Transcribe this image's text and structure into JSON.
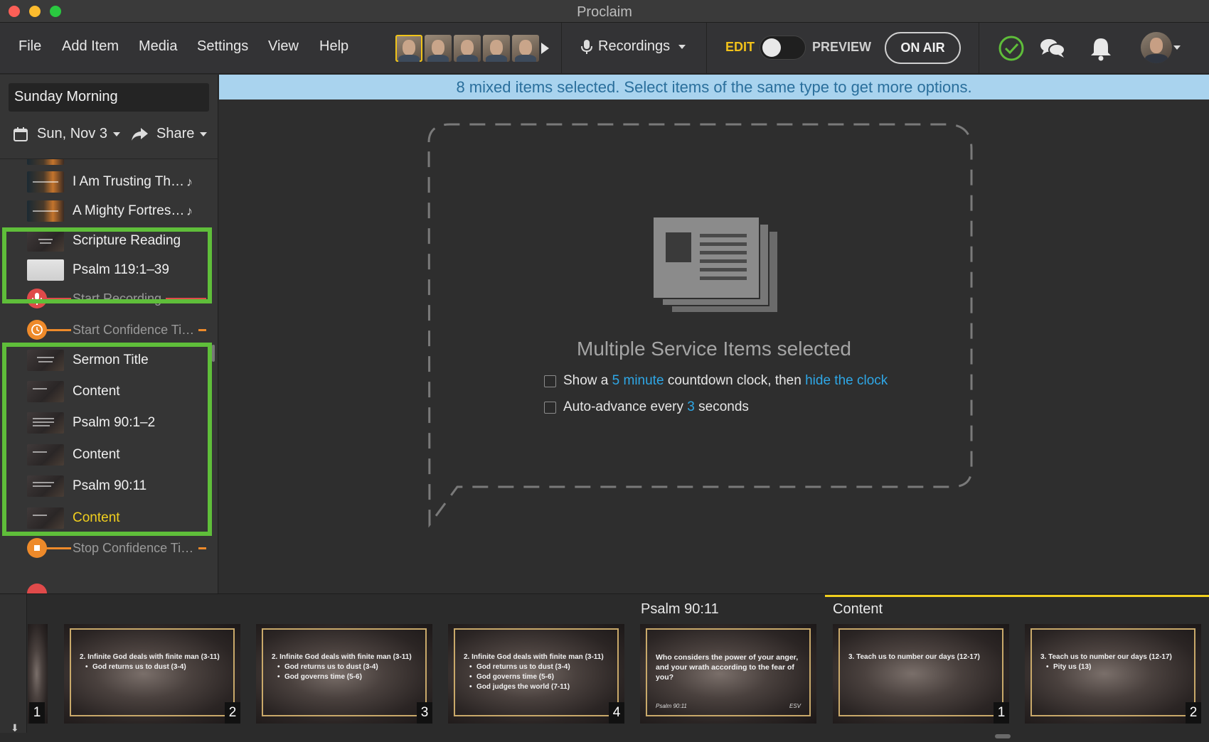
{
  "window": {
    "title": "Proclaim"
  },
  "menu": [
    "File",
    "Add Item",
    "Media",
    "Settings",
    "View",
    "Help"
  ],
  "toolbar": {
    "recordings_label": "Recordings",
    "edit_label": "EDIT",
    "preview_label": "PREVIEW",
    "on_air_label": "ON AIR",
    "mode": "edit",
    "icons": [
      "check-circle-icon",
      "chat-bubbles-icon",
      "bell-icon"
    ]
  },
  "sidebar": {
    "service_name": "Sunday Morning",
    "date_label": "Sun, Nov 3",
    "share_label": "Share",
    "items": [
      {
        "label": "I Am Trusting Th…",
        "kind": "song",
        "thumb": "warm"
      },
      {
        "label": "A Mighty Fortres…",
        "kind": "song",
        "thumb": "warm"
      },
      {
        "label": "Scripture Reading",
        "kind": "item",
        "thumb": "dark"
      },
      {
        "label": "Psalm 119:1–39",
        "kind": "item",
        "thumb": "light"
      },
      {
        "label": "Start Recording",
        "kind": "cue-recording"
      },
      {
        "label": "Start Confidence Ti…",
        "kind": "cue-timer"
      },
      {
        "label": "Sermon Title",
        "kind": "item",
        "thumb": "dark"
      },
      {
        "label": "Content",
        "kind": "item",
        "thumb": "dark"
      },
      {
        "label": "Psalm 90:1–2",
        "kind": "item",
        "thumb": "dark"
      },
      {
        "label": "Content",
        "kind": "item",
        "thumb": "dark"
      },
      {
        "label": "Psalm 90:11",
        "kind": "item",
        "thumb": "dark"
      },
      {
        "label": "Content",
        "kind": "item",
        "thumb": "dark",
        "active": true
      },
      {
        "label": "Stop Confidence Ti…",
        "kind": "cue-timer-stop"
      }
    ]
  },
  "banner": {
    "text": "8 mixed items selected. Select items of the same type to get more options."
  },
  "main": {
    "heading": "Multiple Service Items selected",
    "option1": {
      "prefix": "Show a",
      "minutes_link": "5 minute",
      "middle": "countdown clock, then",
      "action_link": "hide the clock"
    },
    "option2": {
      "prefix": "Auto-advance every",
      "seconds_link": "3",
      "suffix": "seconds"
    }
  },
  "filmstrip": {
    "groups": [
      {
        "title": "Psalm 90:11"
      },
      {
        "title": "Content"
      }
    ],
    "slides": [
      {
        "number": "1",
        "lines": [],
        "partial": true
      },
      {
        "number": "2",
        "heading": "2. Infinite God deals with finite man (3-11)",
        "bullets": [
          "God returns us to dust (3-4)"
        ]
      },
      {
        "number": "3",
        "heading": "2. Infinite God deals with finite man (3-11)",
        "bullets": [
          "God returns us to dust (3-4)",
          "God governs time (5-6)"
        ]
      },
      {
        "number": "4",
        "heading": "2. Infinite God deals with finite man (3-11)",
        "bullets": [
          "God returns us to dust (3-4)",
          "God governs time (5-6)",
          "God judges the world (7-11)"
        ]
      },
      {
        "number": "",
        "heading": "Who considers the power of your anger, and your wrath according to the fear of you?",
        "bullets": [],
        "footer_left": "Psalm 90:11",
        "footer_right": "ESV"
      },
      {
        "number": "1",
        "heading": "3. Teach us to number our days (12-17)",
        "bullets": []
      },
      {
        "number": "2",
        "heading": "3. Teach us to number our days (12-17)",
        "bullets": [
          "Pity us (13)"
        ]
      }
    ]
  },
  "colors": {
    "accent_yellow": "#f1cf1e",
    "selection_green": "#5fbe3a",
    "link_blue": "#2ea7e6",
    "banner_bg": "#a9d3ee",
    "recording_red": "#e04a4a",
    "timer_orange": "#ee8a2a"
  }
}
